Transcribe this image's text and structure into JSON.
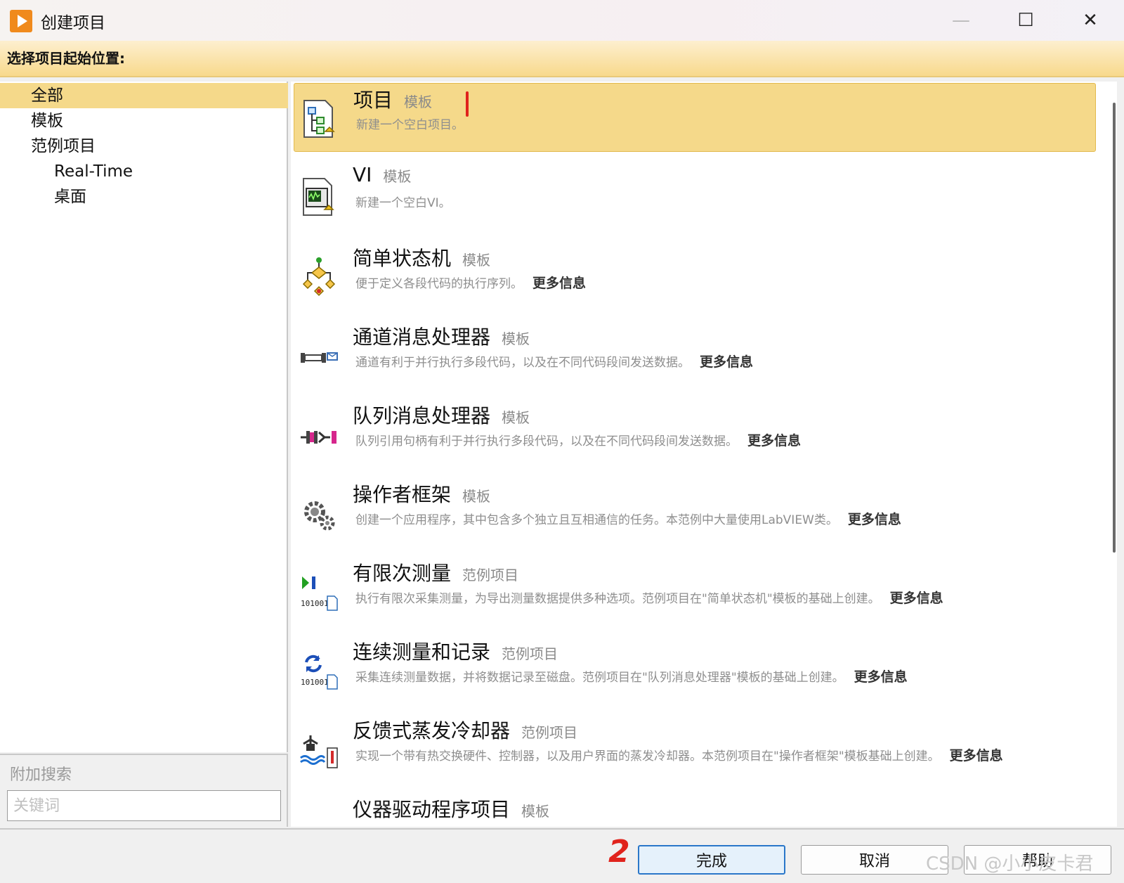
{
  "window": {
    "title": "创建项目",
    "controls": {
      "minimize": "—",
      "maximize": "☐",
      "close": "✕"
    }
  },
  "prompt": "选择项目起始位置:",
  "tree": {
    "items": [
      {
        "label": "全部",
        "selected": true
      },
      {
        "label": "模板"
      },
      {
        "label": "范例项目"
      },
      {
        "label": "Real-Time"
      },
      {
        "label": "桌面"
      }
    ]
  },
  "search": {
    "label": "附加搜索",
    "placeholder": "关键词"
  },
  "list": {
    "items": [
      {
        "name": "项目",
        "type": "模板",
        "desc": "新建一个空白项目。",
        "more": "",
        "icon": "project-icon",
        "selected": true
      },
      {
        "name": "VI",
        "type": "模板",
        "desc": "新建一个空白VI。",
        "more": "",
        "icon": "vi-icon"
      },
      {
        "name": "简单状态机",
        "type": "模板",
        "desc": "便于定义各段代码的执行序列。",
        "more": "更多信息",
        "icon": "state-machine-icon"
      },
      {
        "name": "通道消息处理器",
        "type": "模板",
        "desc": "通道有利于并行执行多段代码，以及在不同代码段间发送数据。",
        "more": "更多信息",
        "icon": "channel-icon"
      },
      {
        "name": "队列消息处理器",
        "type": "模板",
        "desc": "队列引用句柄有利于并行执行多段代码，以及在不同代码段间发送数据。",
        "more": "更多信息",
        "icon": "queue-icon"
      },
      {
        "name": "操作者框架",
        "type": "模板",
        "desc": "创建一个应用程序，其中包含多个独立且互相通信的任务。本范例中大量使用LabVIEW类。",
        "more": "更多信息",
        "icon": "gears-icon"
      },
      {
        "name": "有限次测量",
        "type": "范例项目",
        "desc": "执行有限次采集测量，为导出测量数据提供多种选项。范例项目在\"简单状态机\"模板的基础上创建。",
        "more": "更多信息",
        "icon": "finite-measure-icon"
      },
      {
        "name": "连续测量和记录",
        "type": "范例项目",
        "desc": "采集连续测量数据，并将数据记录至磁盘。范例项目在\"队列消息处理器\"模板的基础上创建。",
        "more": "更多信息",
        "icon": "continuous-measure-icon"
      },
      {
        "name": "反馈式蒸发冷却器",
        "type": "范例项目",
        "desc": "实现一个带有热交换硬件、控制器，以及用户界面的蒸发冷却器。本范例项目在\"操作者框架\"模板基础上创建。",
        "more": "更多信息",
        "icon": "cooler-icon"
      },
      {
        "name": "仪器驱动程序项目",
        "type": "模板",
        "desc": "",
        "more": "",
        "icon": "instrument-driver-icon"
      }
    ]
  },
  "buttons": {
    "finish": "完成",
    "cancel": "取消",
    "help": "帮助"
  },
  "annotations": {
    "mark1": "1",
    "mark2": "2"
  },
  "watermark": "CSDN @小小皮卡君"
}
